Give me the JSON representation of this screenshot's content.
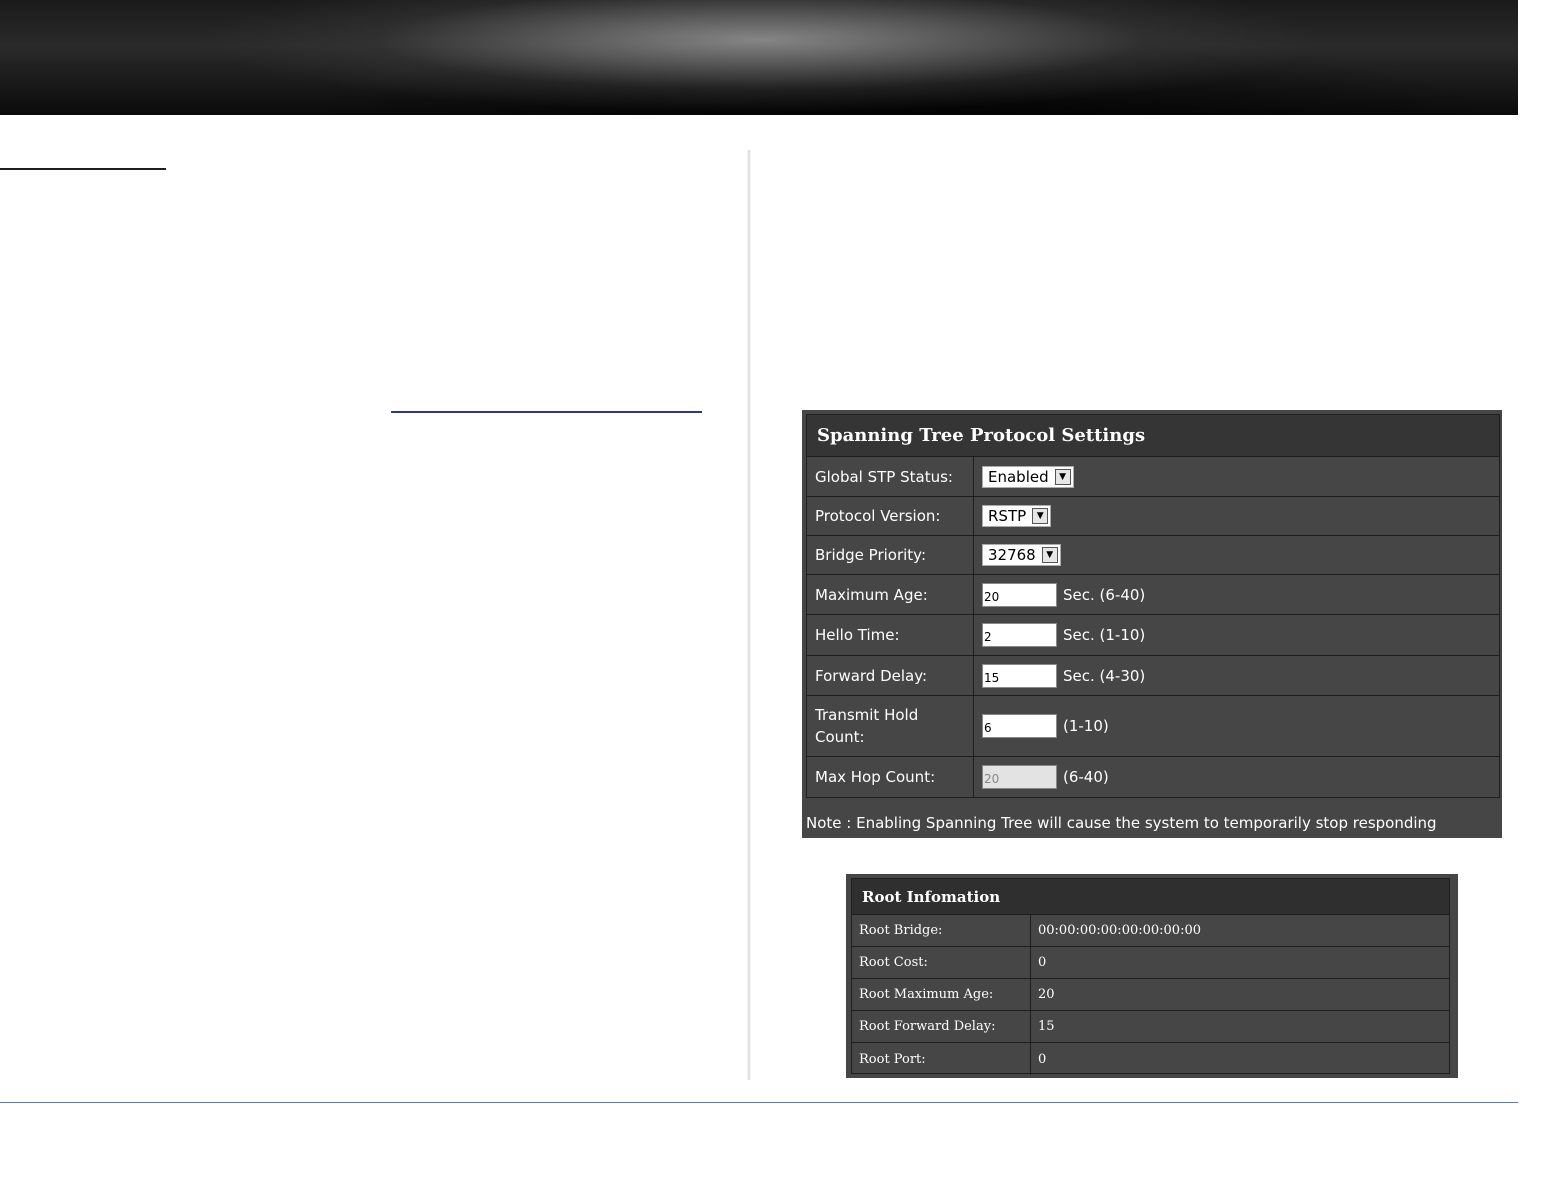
{
  "stp": {
    "title": "Spanning Tree Protocol Settings",
    "rows": [
      {
        "label": "Global STP Status:",
        "value": "Enabled"
      },
      {
        "label": "Protocol Version:",
        "value": "RSTP"
      },
      {
        "label": "Bridge Priority:",
        "value": "32768"
      },
      {
        "label": "Maximum Age:",
        "value": "20",
        "unit": "Sec. (6-40)"
      },
      {
        "label": "Hello Time:",
        "value": "2",
        "unit": "Sec. (1-10)"
      },
      {
        "label": "Forward Delay:",
        "value": "15",
        "unit": "Sec. (4-30)"
      },
      {
        "label": "Transmit Hold Count:",
        "value": "6",
        "unit": "(1-10)"
      },
      {
        "label": "Max Hop Count:",
        "value": "20",
        "unit": "(6-40)",
        "disabled": true
      }
    ],
    "note": "Note : Enabling Spanning Tree will cause the system to temporarily stop responding"
  },
  "root": {
    "title": "Root Infomation",
    "rows": [
      {
        "label": "Root Bridge:",
        "value": "00:00:00:00:00:00:00:00"
      },
      {
        "label": "Root Cost:",
        "value": "0"
      },
      {
        "label": "Root Maximum Age:",
        "value": "20"
      },
      {
        "label": "Root Forward Delay:",
        "value": "15"
      },
      {
        "label": "Root Port:",
        "value": "0"
      }
    ]
  },
  "icons": {
    "dropdown": "chevron-down-icon"
  },
  "colors": {
    "panel_bg": "#464646",
    "title_bg": "#353535",
    "footer_line": "#4a7fd0"
  }
}
